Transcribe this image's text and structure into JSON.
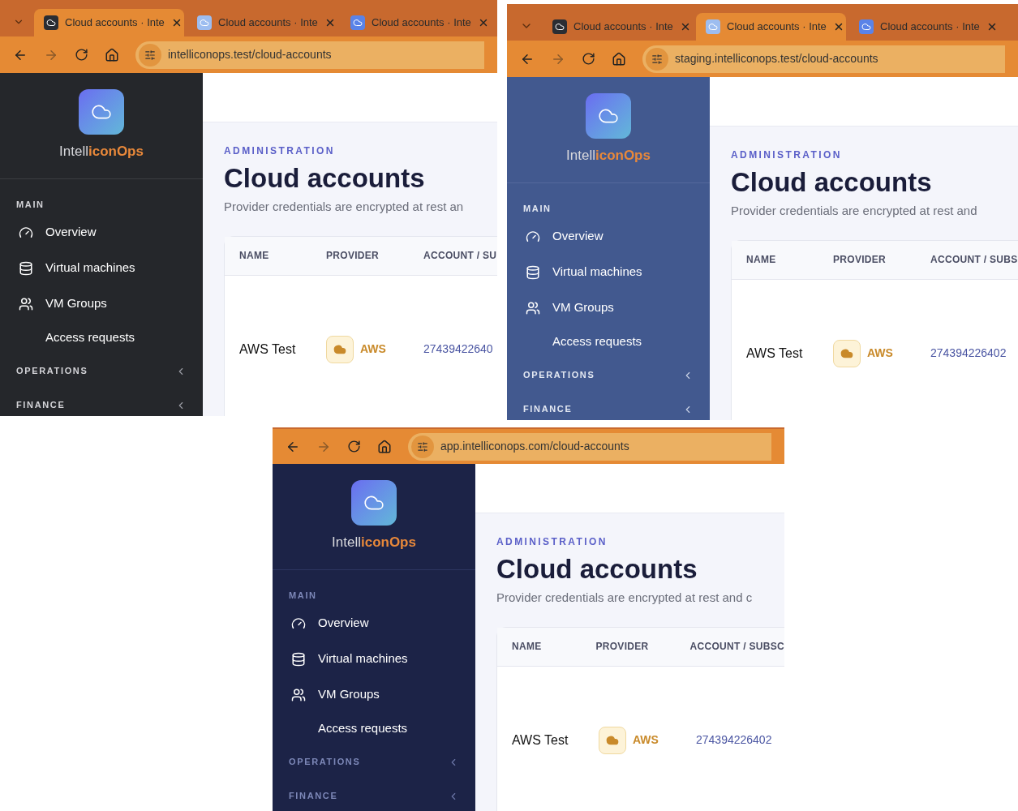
{
  "screenshots": [
    {
      "color": "#25272b",
      "tabs": [
        {
          "title": "Cloud accounts · Inte",
          "selected": true,
          "color": "#2a2d33"
        },
        {
          "title": "Cloud accounts · Inte",
          "selected": false,
          "color": "#9dbdf0"
        },
        {
          "title": "Cloud accounts · Inte",
          "selected": false,
          "color": "#5a83e8"
        }
      ],
      "address": "intelliconops.test/cloud-accounts",
      "brand": {
        "plain": "Intell",
        "accent": "iconOps"
      },
      "sections": [
        {
          "label": "MAIN",
          "collapsible": false,
          "items": [
            {
              "label": "Overview",
              "kind": "gauge"
            },
            {
              "label": "Virtual machines",
              "kind": "database"
            },
            {
              "label": "VM Groups",
              "kind": "users"
            },
            {
              "label": "Access requests",
              "kind": "sub"
            }
          ]
        },
        {
          "label": "OPERATIONS",
          "collapsible": true
        },
        {
          "label": "FINANCE",
          "collapsible": true
        }
      ],
      "page": {
        "eyebrow": "ADMINISTRATION",
        "title": "Cloud accounts",
        "subtitle": "Provider credentials are encrypted at rest an",
        "columns": [
          "NAME",
          "PROVIDER",
          "ACCOUNT / SU"
        ],
        "rows": [
          {
            "name": "AWS Test",
            "provider": "AWS",
            "account": "27439422640"
          }
        ]
      }
    },
    {
      "color": "#42598f",
      "tabs": [
        {
          "title": "Cloud accounts · Inte",
          "selected": false,
          "color": "#2a2d33"
        },
        {
          "title": "Cloud accounts · Inte",
          "selected": true,
          "color": "#9dbdf0"
        },
        {
          "title": "Cloud accounts · Inte",
          "selected": false,
          "color": "#5a83e8"
        }
      ],
      "address": "staging.intelliconops.test/cloud-accounts",
      "brand": {
        "plain": "Intell",
        "accent": "iconOps"
      },
      "sections": [
        {
          "label": "MAIN",
          "collapsible": false,
          "items": [
            {
              "label": "Overview",
              "kind": "gauge"
            },
            {
              "label": "Virtual machines",
              "kind": "database"
            },
            {
              "label": "VM Groups",
              "kind": "users"
            },
            {
              "label": "Access requests",
              "kind": "sub"
            }
          ]
        },
        {
          "label": "OPERATIONS",
          "collapsible": true
        },
        {
          "label": "FINANCE",
          "collapsible": true
        }
      ],
      "page": {
        "eyebrow": "ADMINISTRATION",
        "title": "Cloud accounts",
        "subtitle": "Provider credentials are encrypted at rest and",
        "columns": [
          "NAME",
          "PROVIDER",
          "ACCOUNT / SUBS"
        ],
        "rows": [
          {
            "name": "AWS Test",
            "provider": "AWS",
            "account": "274394226402"
          }
        ]
      }
    },
    {
      "color": "#1c2347",
      "address": "app.intelliconops.com/cloud-accounts",
      "brand": {
        "plain": "Intell",
        "accent": "iconOps"
      },
      "sections": [
        {
          "label": "MAIN",
          "collapsible": false,
          "items": [
            {
              "label": "Overview",
              "kind": "gauge"
            },
            {
              "label": "Virtual machines",
              "kind": "database"
            },
            {
              "label": "VM Groups",
              "kind": "users"
            },
            {
              "label": "Access requests",
              "kind": "sub"
            }
          ]
        },
        {
          "label": "OPERATIONS",
          "collapsible": true
        },
        {
          "label": "FINANCE",
          "collapsible": true
        }
      ],
      "page": {
        "eyebrow": "ADMINISTRATION",
        "title": "Cloud accounts",
        "subtitle": "Provider credentials are encrypted at rest and c",
        "columns": [
          "NAME",
          "PROVIDER",
          "ACCOUNT / SUBSC"
        ],
        "rows": [
          {
            "name": "AWS Test",
            "provider": "AWS",
            "account": "274394226402"
          }
        ]
      }
    }
  ]
}
